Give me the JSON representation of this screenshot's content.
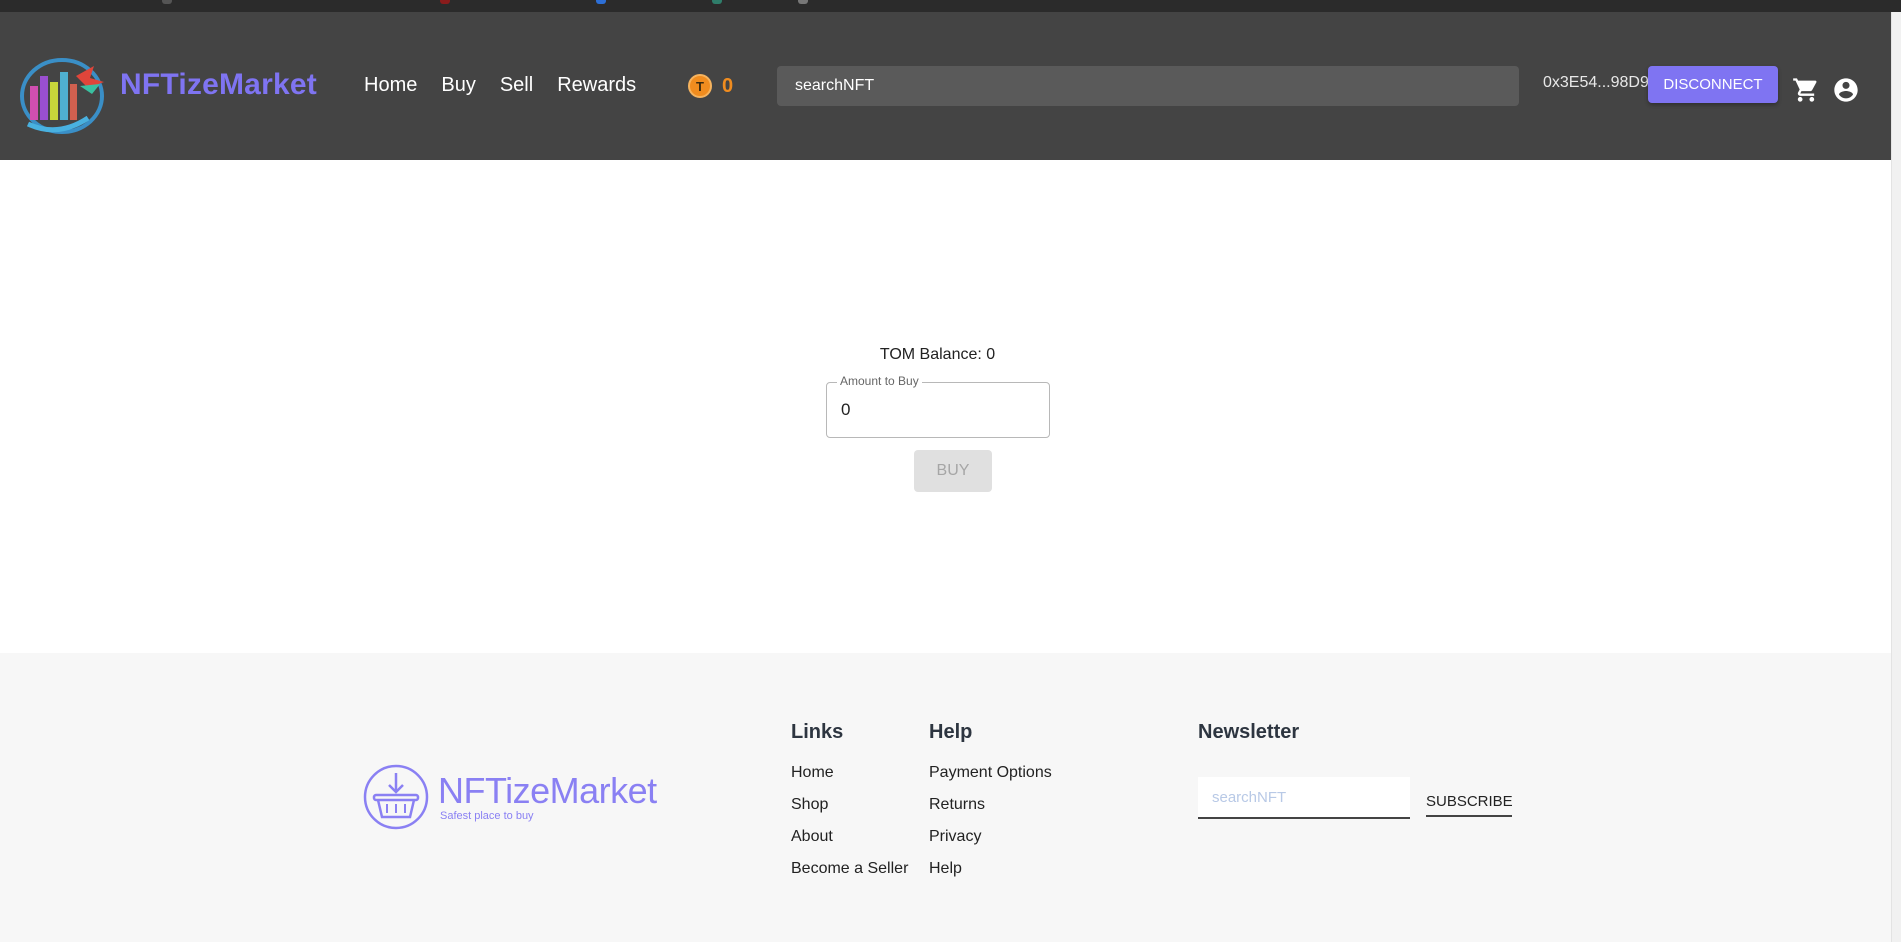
{
  "header": {
    "brand": "NFTizeMarket",
    "nav": [
      {
        "label": "Home"
      },
      {
        "label": "Buy"
      },
      {
        "label": "Sell"
      },
      {
        "label": "Rewards"
      }
    ],
    "token": {
      "icon_letter": "T",
      "value": "0"
    },
    "search": {
      "placeholder": "searchNFT"
    },
    "wallet_address": "0x3E54...98D9",
    "disconnect_label": "DISCONNECT",
    "icons": [
      "cart-icon",
      "account-circle-icon"
    ]
  },
  "main": {
    "balance_label": "TOM Balance: 0",
    "amount_field": {
      "label": "Amount to Buy",
      "value": "0"
    },
    "buy_label": "BUY"
  },
  "footer": {
    "brand": "NFTizeMarket",
    "tagline": "Safest place to buy",
    "links": {
      "title": "Links",
      "items": [
        "Home",
        "Shop",
        "About",
        "Become a Seller"
      ]
    },
    "help": {
      "title": "Help",
      "items": [
        "Payment Options",
        "Returns",
        "Privacy",
        "Help"
      ]
    },
    "newsletter": {
      "title": "Newsletter",
      "placeholder": "searchNFT",
      "subscribe_label": "SUBSCRIBE"
    }
  },
  "colors": {
    "header_bg": "#444444",
    "accent": "#7f74f2",
    "token": "#f08c1f",
    "footer_bg": "#f7f7f7"
  }
}
